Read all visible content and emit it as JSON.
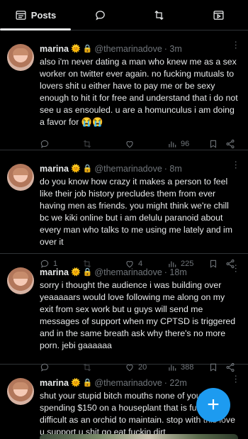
{
  "tabs": [
    {
      "label": "Posts",
      "icon": "posts-icon"
    },
    {
      "label": "",
      "icon": "reply-icon"
    },
    {
      "label": "",
      "icon": "repost-icon"
    },
    {
      "label": "",
      "icon": "media-icon"
    }
  ],
  "posts": [
    {
      "name": "marina",
      "emoji": "🌞",
      "lock": "🔒",
      "handle": "@themarinadove",
      "time": "· 3m",
      "text": "also i'm never dating a man who knew me as a sex worker on twitter ever again. no fucking mutuals to lovers shit u either have to pay me or be sexy enough to hit it for free and understand that i do not see u as ensouled. u are a homunculus i am doing a favor for 😭😭",
      "replies": "",
      "reposts": "",
      "likes": "",
      "views": "96"
    },
    {
      "name": "marina",
      "emoji": "🌞",
      "lock": "🔒",
      "handle": "@themarinadove",
      "time": "· 8m",
      "text": "do you know how crazy it makes a person to feel like their job history precludes them from ever having men as friends. you might think we're chill bc we kiki online but i am delulu paranoid about every man who talks to me using me lately and im over it",
      "replies": "1",
      "reposts": "",
      "likes": "4",
      "views": "225"
    },
    {
      "name": "marina",
      "emoji": "🌞",
      "lock": "🔒",
      "handle": "@themarinadove",
      "time": "· 18m",
      "text": "sorry i thought the audience i was building over yeaaaaars would love following me along on my exit from sex work but u guys will send me messages of support when my CPTSD is triggered and in the same breath ask why there's no more porn. jebi gaaaaaa",
      "replies": "",
      "reposts": "",
      "likes": "20",
      "views": "388"
    },
    {
      "name": "marina",
      "emoji": "🌞",
      "lock": "🔒",
      "handle": "@themarinadove",
      "time": "· 22m",
      "text": "shut your stupid bitch mouths none of you are spending $150 on a houseplant that is fully as difficult as an orchid to maintain. stop with this love u support u shit go eat fuckin dirt"
    }
  ],
  "compose": {
    "icon": "plus-icon",
    "glyph": "+"
  },
  "colors": {
    "accent": "#1d9bf0",
    "muted": "#71767b",
    "text": "#e7e9ea",
    "background": "#000000"
  }
}
